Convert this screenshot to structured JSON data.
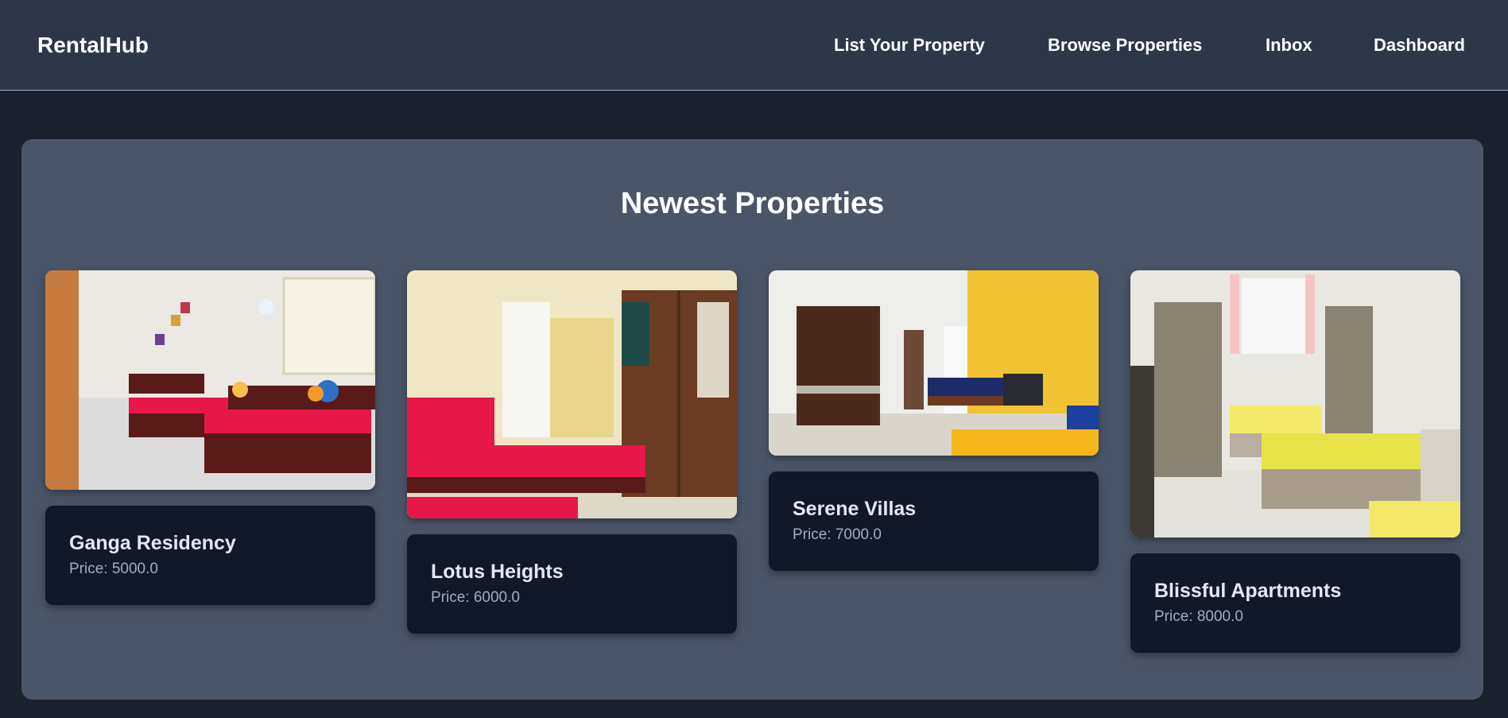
{
  "navbar": {
    "brand": "RentalHub",
    "links": [
      "List Your Property",
      "Browse Properties",
      "Inbox",
      "Dashboard"
    ]
  },
  "newest": {
    "title": "Newest Properties",
    "properties": [
      {
        "name": "Ganga Residency",
        "price": "Price: 5000.0"
      },
      {
        "name": "Lotus Heights",
        "price": "Price: 6000.0"
      },
      {
        "name": "Serene Villas",
        "price": "Price: 7000.0"
      },
      {
        "name": "Blissful Apartments",
        "price": "Price: 8000.0"
      }
    ]
  },
  "colors": {
    "navbar_bg": "#2d3748",
    "page_bg": "#1a202c",
    "panel_bg": "#4a5568",
    "card_info_bg": "#111827"
  }
}
